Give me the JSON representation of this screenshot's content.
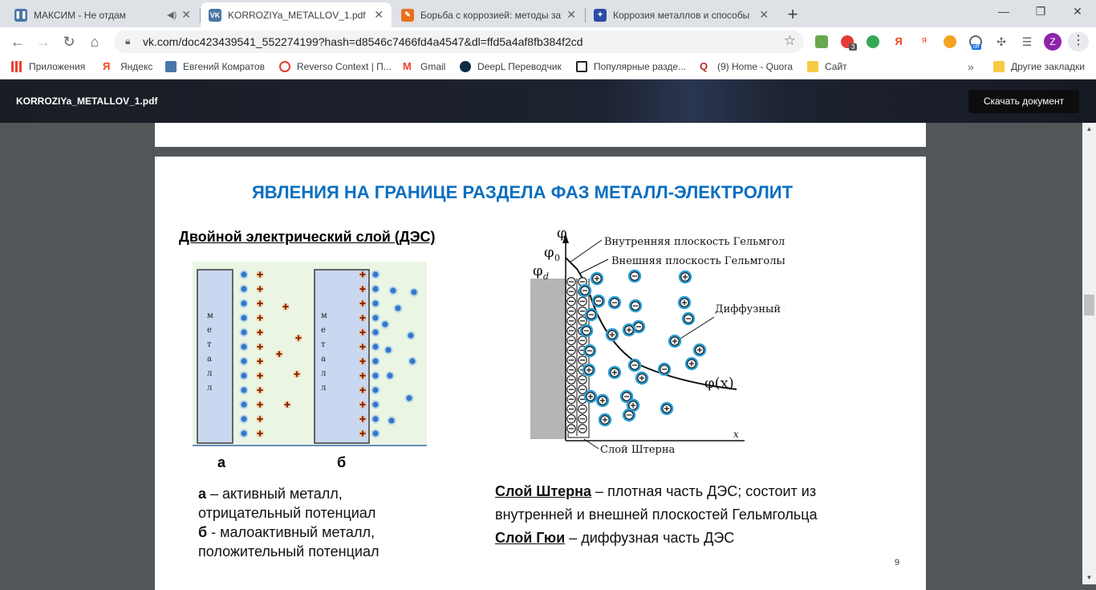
{
  "browser": {
    "tabs": [
      {
        "title": "МАКСИМ - Не отдам",
        "favicon": "pause-icon",
        "color": "#4a76a8"
      },
      {
        "title": "KORROZIYa_METALLOV_1.pdf",
        "favicon": "vk-icon",
        "color": "#4a76a8"
      },
      {
        "title": "Борьба с коррозией: методы за",
        "favicon": "hammer-icon",
        "color": "#e8711c"
      },
      {
        "title": "Коррозия металлов и способы",
        "favicon": "compass-icon",
        "color": "#2b4aa8"
      }
    ],
    "url": "vk.com/doc423439541_552274199?hash=d8546c7466fd4a4547&dl=ffd5a4af8fb384f2cd",
    "profile_letter": "Z",
    "badge_count": "3",
    "off_badge": "off"
  },
  "bookmarks": [
    {
      "label": "Приложения",
      "icon": "apps-grid-icon",
      "color": "#ea4335"
    },
    {
      "label": "Яндекс",
      "icon": "yandex-icon",
      "color": "#fc3f1d"
    },
    {
      "label": "Евгений Комратов",
      "icon": "play-icon",
      "color": "#4a76a8"
    },
    {
      "label": "Reverso Context | П...",
      "icon": "reverso-icon",
      "color": "#e23c2c"
    },
    {
      "label": "Gmail",
      "icon": "gmail-icon",
      "color": "#ea4335"
    },
    {
      "label": "DeepL Переводчик",
      "icon": "deepl-icon",
      "color": "#0f2b46"
    },
    {
      "label": "Популярные разде...",
      "icon": "e-icon",
      "color": "#222222"
    },
    {
      "label": "(9) Home - Quora",
      "icon": "quora-icon",
      "color": "#b92b27"
    },
    {
      "label": "Сайт",
      "icon": "folder-icon",
      "color": "#f8c944"
    },
    {
      "label": "Другие закладки",
      "icon": "folder-icon",
      "color": "#f8c944"
    }
  ],
  "viewer": {
    "filename": "KORROZIYa_METALLOV_1.pdf",
    "download_label": "Скачать документ"
  },
  "slide": {
    "title": "ЯВЛЕНИЯ НА ГРАНИЦЕ РАЗДЕЛА ФАЗ МЕТАЛЛ-ЭЛЕКТРОЛИТ",
    "subtitle": "Двойной электрический слой (ДЭС)",
    "label_a": "а",
    "label_b": "б",
    "desc_a_key": "а",
    "desc_a_text": " – активный металл,",
    "desc_a_text2": "отрицательный потенциал",
    "desc_b_key": "б",
    "desc_b_text": " -  малоактивный металл,",
    "desc_b_text2": "положительный потенциал",
    "stern_key": "Слой Штерна",
    "stern_text": " – плотная часть ДЭС; состоит из",
    "stern_text2": "внутренней и внешней плоскостей Гельмгольца",
    "gouy_key": "Слой Гюи",
    "gouy_text": " – диффузная часть ДЭС",
    "page_number": "9",
    "metal_vertical_label": "металл",
    "diagram": {
      "phi": "φ",
      "phi0": "φ",
      "phi0_sub": "0",
      "phid": "φ",
      "phid_sub": "d",
      "inner_helmholtz": "Внутренняя плоскость Гельмгольца",
      "outer_helmholtz": "Внешняя плоскость Гельмгольца",
      "diffuse_layer": "Диффузный слой",
      "curve_label": "φ(x)",
      "x_axis": "x",
      "stern_layer": "Слой Штерна"
    }
  }
}
